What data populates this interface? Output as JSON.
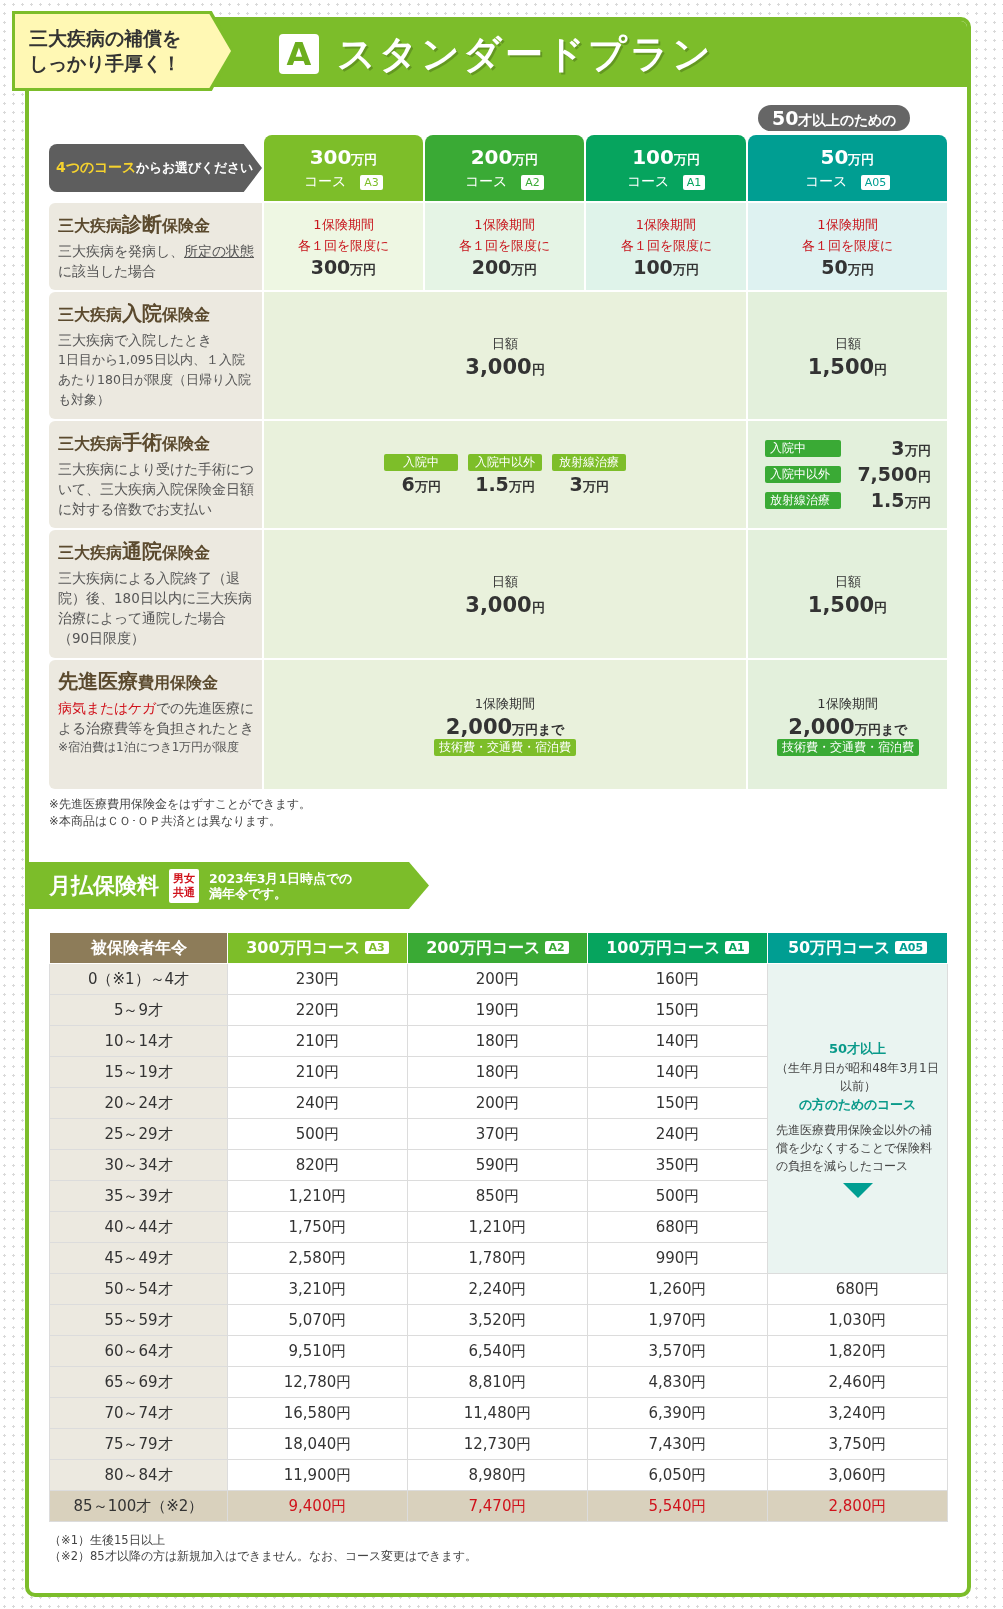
{
  "callout": {
    "lines": [
      "三大疾病の補償を",
      "しっかり手厚く！"
    ]
  },
  "plan": {
    "letter": "A",
    "title": "スタンダードプラン"
  },
  "course_picker": {
    "highlight": "4つのコース",
    "rest": "からお選びください"
  },
  "courses": [
    {
      "amount": "300",
      "unit": "万円",
      "label": "コース",
      "code": "A3",
      "color": "#7dbe29"
    },
    {
      "amount": "200",
      "unit": "万円",
      "label": "コース",
      "code": "A2",
      "color": "#3aaa35"
    },
    {
      "amount": "100",
      "unit": "万円",
      "label": "コース",
      "code": "A1",
      "color": "#06a45e"
    },
    {
      "amount": "50",
      "unit": "万円",
      "label": "コース",
      "code": "A05",
      "color": "#009e92",
      "ribbon": {
        "number": "50",
        "text": "才以上のための"
      }
    }
  ],
  "benefits": [
    {
      "title": [
        {
          "text": "三大疾病",
          "big": false
        },
        {
          "text": "診断",
          "big": true
        },
        {
          "text": "保険金",
          "big": false
        }
      ],
      "description": [
        {
          "text": "三大疾病を発病し、",
          "kind": "plain"
        },
        {
          "text": "所定の状態",
          "kind": "underlined"
        },
        {
          "text": "に該当した場合",
          "kind": "plain"
        }
      ],
      "cells": [
        {
          "kind": "limit",
          "lines": [
            "1保険期間",
            "各１回を限度に"
          ],
          "amount": "300",
          "unit": "万円"
        },
        {
          "kind": "limit",
          "lines": [
            "1保険期間",
            "各１回を限度に"
          ],
          "amount": "200",
          "unit": "万円"
        },
        {
          "kind": "limit",
          "lines": [
            "1保険期間",
            "各１回を限度に"
          ],
          "amount": "100",
          "unit": "万円"
        },
        {
          "kind": "limit",
          "lines": [
            "1保険期間",
            "各１回を限度に"
          ],
          "amount": "50",
          "unit": "万円"
        }
      ]
    },
    {
      "title": [
        {
          "text": "三大疾病",
          "big": false
        },
        {
          "text": "入院",
          "big": true
        },
        {
          "text": "保険金",
          "big": false
        }
      ],
      "description": [
        {
          "text": "三大疾病で入院したとき",
          "kind": "plain"
        }
      ],
      "detail": "1日目から1,095日以内、１入院あたり180日が限度（日帰り入院も対象）",
      "cells": [
        {
          "kind": "daily",
          "label": "日額",
          "amount": "3,000",
          "unit": "円"
        },
        {
          "kind": "daily",
          "label": "日額",
          "amount": "1,500",
          "unit": "円"
        }
      ]
    },
    {
      "title": [
        {
          "text": "三大疾病",
          "big": false
        },
        {
          "text": "手術",
          "big": true
        },
        {
          "text": "保険金",
          "big": false
        }
      ],
      "description": [
        {
          "text": "三大疾病により受けた手術について、三大疾病入院保険金日額に対する倍数でお支払い",
          "kind": "plain"
        }
      ],
      "cells": [
        {
          "kind": "surgery_row",
          "items": [
            {
              "tag": "入院中",
              "amount": "6",
              "unit": "万円"
            },
            {
              "tag": "入院中以外",
              "amount": "1.5",
              "unit": "万円"
            },
            {
              "tag": "放射線治療",
              "amount": "3",
              "unit": "万円"
            }
          ]
        },
        {
          "kind": "surgery_list",
          "items": [
            {
              "tag": "入院中",
              "amount": "3",
              "unit": "万円"
            },
            {
              "tag": "入院中以外",
              "amount": "7,500",
              "unit": "円"
            },
            {
              "tag": "放射線治療",
              "amount": "1.5",
              "unit": "万円"
            }
          ]
        }
      ]
    },
    {
      "title": [
        {
          "text": "三大疾病",
          "big": false
        },
        {
          "text": "通院",
          "big": true
        },
        {
          "text": "保険金",
          "big": false
        }
      ],
      "description": [
        {
          "text": "三大疾病による入院終了（退院）後、180日以内に三大疾病治療によって通院した場合（90日限度）",
          "kind": "plain"
        }
      ],
      "cells": [
        {
          "kind": "daily",
          "label": "日額",
          "amount": "3,000",
          "unit": "円"
        },
        {
          "kind": "daily",
          "label": "日額",
          "amount": "1,500",
          "unit": "円"
        }
      ]
    },
    {
      "title": [
        {
          "text": "先進医療",
          "big": true
        },
        {
          "text": "費用保険金",
          "big": false
        }
      ],
      "description": [
        {
          "text": "病気またはケガ",
          "kind": "emphasis"
        },
        {
          "text": "での先進医療による治療費等を負担されたとき",
          "kind": "plain"
        }
      ],
      "note": "※宿泊費は1泊につき1万円が限度",
      "cells": [
        {
          "kind": "advanced",
          "label": "1保険期間",
          "amount": "2,000",
          "unit": "万円まで",
          "tag": "技術費・交通費・宿泊費"
        },
        {
          "kind": "advanced",
          "label": "1保険期間",
          "amount": "2,000",
          "unit": "万円まで",
          "tag": "技術費・交通費・宿泊費"
        }
      ]
    }
  ],
  "benefit_notes": [
    "※先進医療費用保険金をはずすことができます。",
    "※本商品はＣＯ･ＯＰ共済とは異なります。"
  ],
  "premium_section": {
    "title": "月払保険料",
    "gender_badge": [
      "男女",
      "共通"
    ],
    "note": [
      "2023年3月1日時点での",
      "満年令です。"
    ]
  },
  "premium_table": {
    "columns": [
      {
        "label": "被保険者年令"
      },
      {
        "label": "300万円コース",
        "code": "A3",
        "color": "#7dbe29"
      },
      {
        "label": "200万円コース",
        "code": "A2",
        "color": "#3aaa35"
      },
      {
        "label": "100万円コース",
        "code": "A1",
        "color": "#06a45e"
      },
      {
        "label": "50万円コース",
        "code": "A05",
        "color": "#009e92"
      }
    ],
    "merged_note": {
      "title": "50才以上",
      "sub": "（生年月日が昭和48年3月1日以前）",
      "title2": "の方のためのコース",
      "body": "先進医療費用保険金以外の補償を少なくすることで保険料の負担を減らしたコース"
    },
    "rows": [
      {
        "age": "0（※1）～4才",
        "values": [
          "230円",
          "200円",
          "160円"
        ],
        "highlighted": false
      },
      {
        "age": "5～9才",
        "values": [
          "220円",
          "190円",
          "150円"
        ],
        "highlighted": false
      },
      {
        "age": "10～14才",
        "values": [
          "210円",
          "180円",
          "140円"
        ],
        "highlighted": false
      },
      {
        "age": "15～19才",
        "values": [
          "210円",
          "180円",
          "140円"
        ],
        "highlighted": false
      },
      {
        "age": "20～24才",
        "values": [
          "240円",
          "200円",
          "150円"
        ],
        "highlighted": false
      },
      {
        "age": "25～29才",
        "values": [
          "500円",
          "370円",
          "240円"
        ],
        "highlighted": false
      },
      {
        "age": "30～34才",
        "values": [
          "820円",
          "590円",
          "350円"
        ],
        "highlighted": false
      },
      {
        "age": "35～39才",
        "values": [
          "1,210円",
          "850円",
          "500円"
        ],
        "highlighted": false
      },
      {
        "age": "40～44才",
        "values": [
          "1,750円",
          "1,210円",
          "680円"
        ],
        "highlighted": false
      },
      {
        "age": "45～49才",
        "values": [
          "2,580円",
          "1,780円",
          "990円"
        ],
        "highlighted": false
      },
      {
        "age": "50～54才",
        "values": [
          "3,210円",
          "2,240円",
          "1,260円",
          "680円"
        ],
        "highlighted": false
      },
      {
        "age": "55～59才",
        "values": [
          "5,070円",
          "3,520円",
          "1,970円",
          "1,030円"
        ],
        "highlighted": false
      },
      {
        "age": "60～64才",
        "values": [
          "9,510円",
          "6,540円",
          "3,570円",
          "1,820円"
        ],
        "highlighted": false
      },
      {
        "age": "65～69才",
        "values": [
          "12,780円",
          "8,810円",
          "4,830円",
          "2,460円"
        ],
        "highlighted": false
      },
      {
        "age": "70～74才",
        "values": [
          "16,580円",
          "11,480円",
          "6,390円",
          "3,240円"
        ],
        "highlighted": false
      },
      {
        "age": "75～79才",
        "values": [
          "18,040円",
          "12,730円",
          "7,430円",
          "3,750円"
        ],
        "highlighted": false
      },
      {
        "age": "80～84才",
        "values": [
          "11,900円",
          "8,980円",
          "6,050円",
          "3,060円"
        ],
        "highlighted": false
      },
      {
        "age": "85～100才（※2）",
        "values": [
          "9,400円",
          "7,470円",
          "5,540円",
          "2,800円"
        ],
        "highlighted": true
      }
    ]
  },
  "premium_notes": [
    "（※1）生後15日以上",
    "（※2）85才以降の方は新規加入はできません。なお、コース変更はできます。"
  ]
}
